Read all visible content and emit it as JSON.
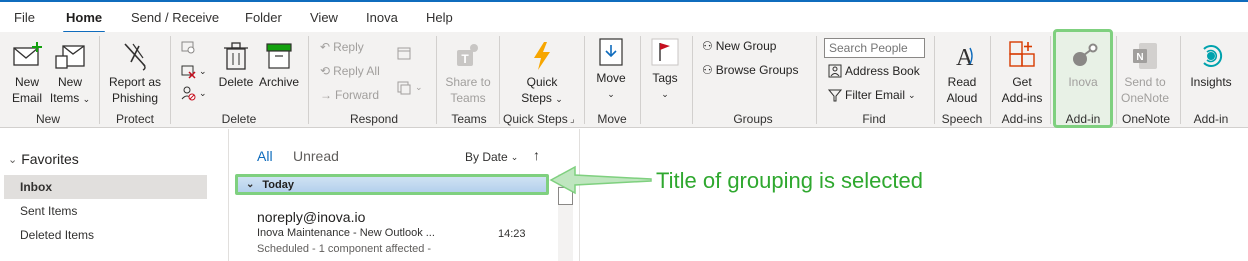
{
  "menu": {
    "items": [
      "File",
      "Home",
      "Send / Receive",
      "Folder",
      "View",
      "Inova",
      "Help"
    ],
    "active": "Home"
  },
  "ribbon": {
    "new_email": [
      "New",
      "Email"
    ],
    "new_items": [
      "New",
      "Items"
    ],
    "report_phishing": [
      "Report as",
      "Phishing"
    ],
    "delete": "Delete",
    "archive": "Archive",
    "reply": "Reply",
    "reply_all": "Reply All",
    "forward": "Forward",
    "share_teams": [
      "Share to",
      "Teams"
    ],
    "quick_steps": [
      "Quick",
      "Steps"
    ],
    "move": "Move",
    "tags": "Tags",
    "new_group": "New Group",
    "browse_groups": "Browse Groups",
    "search_people_placeholder": "Search People",
    "address_book": "Address Book",
    "filter_email": "Filter Email",
    "read_aloud": [
      "Read",
      "Aloud"
    ],
    "get_addins": [
      "Get",
      "Add-ins"
    ],
    "inova": "Inova",
    "send_onenote": [
      "Send to",
      "OneNote"
    ],
    "insights": "Insights",
    "groups": [
      "New",
      "Protect",
      "Delete",
      "Respond",
      "Teams",
      "Quick Steps",
      "Move",
      "Groups",
      "Find",
      "Speech",
      "Add-ins",
      "Add-in",
      "OneNote",
      "Add-in"
    ]
  },
  "folders": {
    "header": "Favorites",
    "items": [
      "Inbox",
      "Sent Items",
      "Deleted Items"
    ],
    "selected": "Inbox"
  },
  "message_list": {
    "filter_all": "All",
    "filter_unread": "Unread",
    "sort_by": "By Date",
    "group_title": "Today",
    "messages": [
      {
        "sender": "noreply@inova.io",
        "subject": "Inova Maintenance - New Outlook ...",
        "time": "14:23",
        "preview": "Scheduled - 1 component affected -"
      }
    ]
  },
  "annotation": {
    "text": "Title of grouping is selected",
    "color": "#2fa82f"
  },
  "colors": {
    "accent": "#0f6cbd",
    "highlight": "#7fd07f"
  }
}
